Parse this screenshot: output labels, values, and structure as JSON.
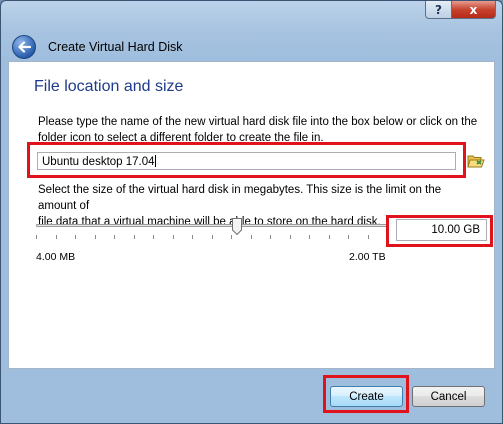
{
  "titlebar": {
    "help_label": "?",
    "close_label": "x"
  },
  "header": {
    "title": "Create Virtual Hard Disk"
  },
  "page": {
    "title": "File location and size",
    "file_desc_line1": "Please type the name of the new virtual hard disk file into the box below or click on the",
    "file_desc_line2": "folder icon to select a different folder to create the file in.",
    "file_name": "Ubuntu desktop 17.04",
    "size_desc_line1": "Select the size of the virtual hard disk in megabytes. This size is the limit on the amount of",
    "size_desc_line2": "file data that a virtual machine will be able to store on the hard disk.",
    "size_value": "10.00 GB",
    "size_level_fraction": 0.57,
    "min_label": "4.00 MB",
    "max_label": "2.00 TB"
  },
  "buttons": {
    "create": "Create",
    "cancel": "Cancel"
  },
  "colors": {
    "highlight": "#e0121b",
    "title_blue": "#1e3a8a"
  },
  "icons": [
    "back-arrow-icon",
    "folder-icon",
    "help-icon",
    "close-icon"
  ]
}
